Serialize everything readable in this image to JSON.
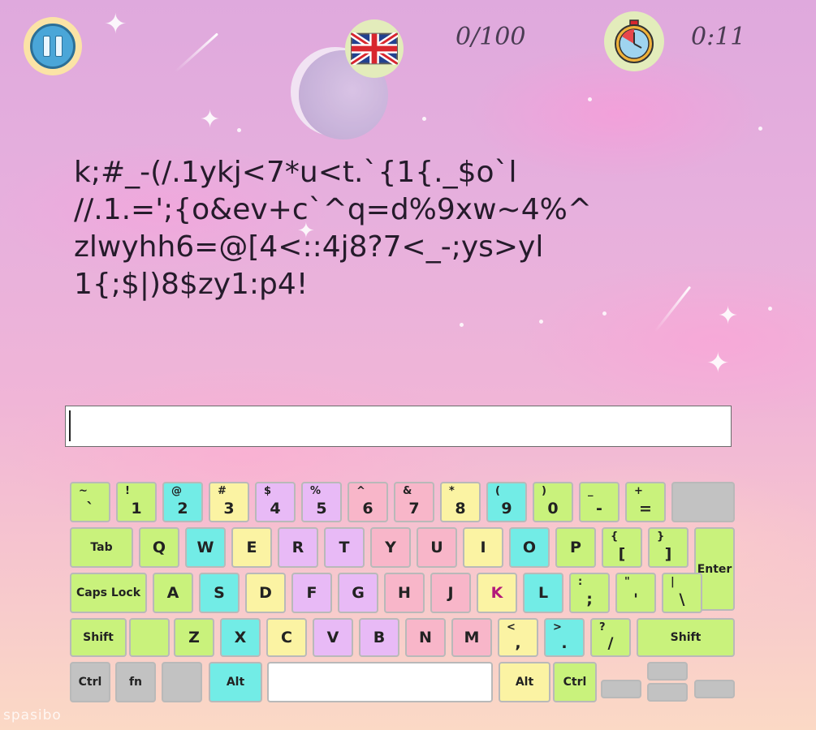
{
  "hud": {
    "pause_icon": "pause-icon",
    "language_icon": "uk-flag-icon",
    "score": "0/100",
    "timer_icon": "stopwatch-icon",
    "time": "0:11"
  },
  "passage": {
    "lines": [
      "k;#_-(/.1ykj<7*u<t.`{1{._$o`l",
      "//.1.=';{o&ev+c`^q=d%9xw~4%^",
      "zlwyhh6=@[4<::4j8?7<_-;ys>yl",
      "1{;$|)8$zy1:p4!"
    ]
  },
  "input": {
    "value": "",
    "placeholder": ""
  },
  "highlighted_key": "K",
  "colors": {
    "lime": "#c9f27c",
    "cyan": "#72ece6",
    "yellow": "#fbf3a3",
    "lavender": "#e8baf6",
    "pink": "#f8b6c9",
    "gray": "#c2c2c2",
    "highlight_text": "#b3197b"
  },
  "keyboard": {
    "row1": [
      {
        "shift": "~",
        "base": "`"
      },
      {
        "shift": "!",
        "base": "1"
      },
      {
        "shift": "@",
        "base": "2"
      },
      {
        "shift": "#",
        "base": "3"
      },
      {
        "shift": "$",
        "base": "4"
      },
      {
        "shift": "%",
        "base": "5"
      },
      {
        "shift": "^",
        "base": "6"
      },
      {
        "shift": "&",
        "base": "7"
      },
      {
        "shift": "*",
        "base": "8"
      },
      {
        "shift": "(",
        "base": "9"
      },
      {
        "shift": ")",
        "base": "0"
      },
      {
        "shift": "_",
        "base": "-"
      },
      {
        "shift": "+",
        "base": "="
      },
      {
        "shift": "",
        "base": ""
      }
    ],
    "row2": [
      {
        "label": "Tab"
      },
      {
        "label": "Q"
      },
      {
        "label": "W"
      },
      {
        "label": "E"
      },
      {
        "label": "R"
      },
      {
        "label": "T"
      },
      {
        "label": "Y"
      },
      {
        "label": "U"
      },
      {
        "label": "I"
      },
      {
        "label": "O"
      },
      {
        "label": "P"
      },
      {
        "shift": "{",
        "base": "["
      },
      {
        "shift": "}",
        "base": "]"
      },
      {
        "label": "Enter"
      }
    ],
    "row3": [
      {
        "label": "Caps Lock"
      },
      {
        "label": "A"
      },
      {
        "label": "S"
      },
      {
        "label": "D"
      },
      {
        "label": "F"
      },
      {
        "label": "G"
      },
      {
        "label": "H"
      },
      {
        "label": "J"
      },
      {
        "label": "K"
      },
      {
        "label": "L"
      },
      {
        "shift": ":",
        "base": ";"
      },
      {
        "shift": "\"",
        "base": "'"
      },
      {
        "shift": "|",
        "base": "\\"
      }
    ],
    "row4": [
      {
        "label": "Shift"
      },
      {
        "label": ""
      },
      {
        "label": "Z"
      },
      {
        "label": "X"
      },
      {
        "label": "C"
      },
      {
        "label": "V"
      },
      {
        "label": "B"
      },
      {
        "label": "N"
      },
      {
        "label": "M"
      },
      {
        "shift": "<",
        "base": ","
      },
      {
        "shift": ">",
        "base": "."
      },
      {
        "shift": "?",
        "base": "/"
      },
      {
        "label": "Shift"
      }
    ],
    "row5": [
      {
        "label": "Ctrl"
      },
      {
        "label": "fn"
      },
      {
        "label": ""
      },
      {
        "label": "Alt"
      },
      {
        "label": ""
      },
      {
        "label": "Alt"
      },
      {
        "label": "Ctrl"
      },
      {
        "label": ""
      },
      {
        "label": ""
      },
      {
        "label": ""
      },
      {
        "label": ""
      }
    ]
  },
  "watermark": "spasibo"
}
